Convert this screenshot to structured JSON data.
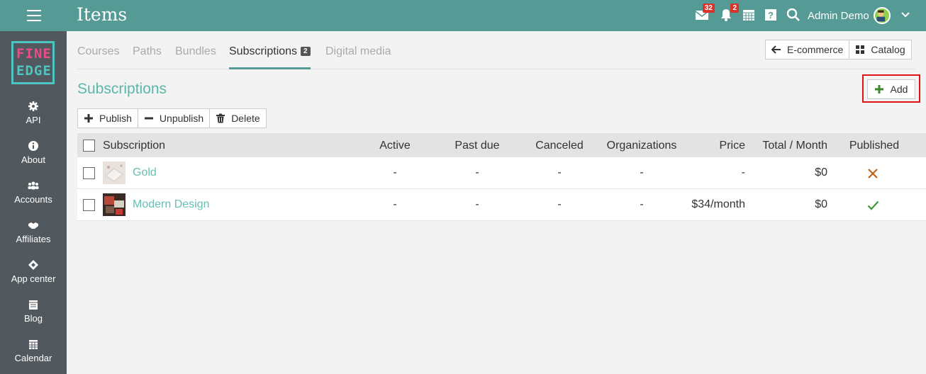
{
  "header": {
    "title": "Items",
    "messages_badge": "32",
    "notifications_badge": "2",
    "user_name": "Admin Demo"
  },
  "logo": {
    "line1": "FINE",
    "line2": "EDGE"
  },
  "sidebar": {
    "items": [
      {
        "label": "API",
        "icon": "gear-icon"
      },
      {
        "label": "About",
        "icon": "info-icon"
      },
      {
        "label": "Accounts",
        "icon": "users-icon"
      },
      {
        "label": "Affiliates",
        "icon": "handshake-icon"
      },
      {
        "label": "App center",
        "icon": "diamond-icon"
      },
      {
        "label": "Blog",
        "icon": "calendar-list-icon"
      },
      {
        "label": "Calendar",
        "icon": "calendar-grid-icon"
      }
    ]
  },
  "tabs": [
    {
      "label": "Courses"
    },
    {
      "label": "Paths"
    },
    {
      "label": "Bundles"
    },
    {
      "label": "Subscriptions",
      "badge": "2"
    },
    {
      "label": "Digital media"
    }
  ],
  "nav_buttons": {
    "ecommerce": "E-commerce",
    "catalog": "Catalog"
  },
  "section": {
    "title": "Subscriptions",
    "add_label": "Add"
  },
  "actions": {
    "publish": "Publish",
    "unpublish": "Unpublish",
    "delete": "Delete"
  },
  "table": {
    "columns": [
      "Subscription",
      "Active",
      "Past due",
      "Canceled",
      "Organizations",
      "Price",
      "Total / Month",
      "Published"
    ],
    "rows": [
      {
        "name": "Gold",
        "active": "-",
        "past_due": "-",
        "canceled": "-",
        "organizations": "-",
        "price": "-",
        "total": "$0",
        "published": "no"
      },
      {
        "name": "Modern Design",
        "active": "-",
        "past_due": "-",
        "canceled": "-",
        "organizations": "-",
        "price": "$34/month",
        "total": "$0",
        "published": "yes"
      }
    ]
  },
  "colors": {
    "header": "#559a94",
    "sidebar": "#51595f",
    "accent": "#5bb8a8",
    "cross": "#c0651c",
    "check": "#3a9a3a",
    "highlight": "#e0131b"
  }
}
